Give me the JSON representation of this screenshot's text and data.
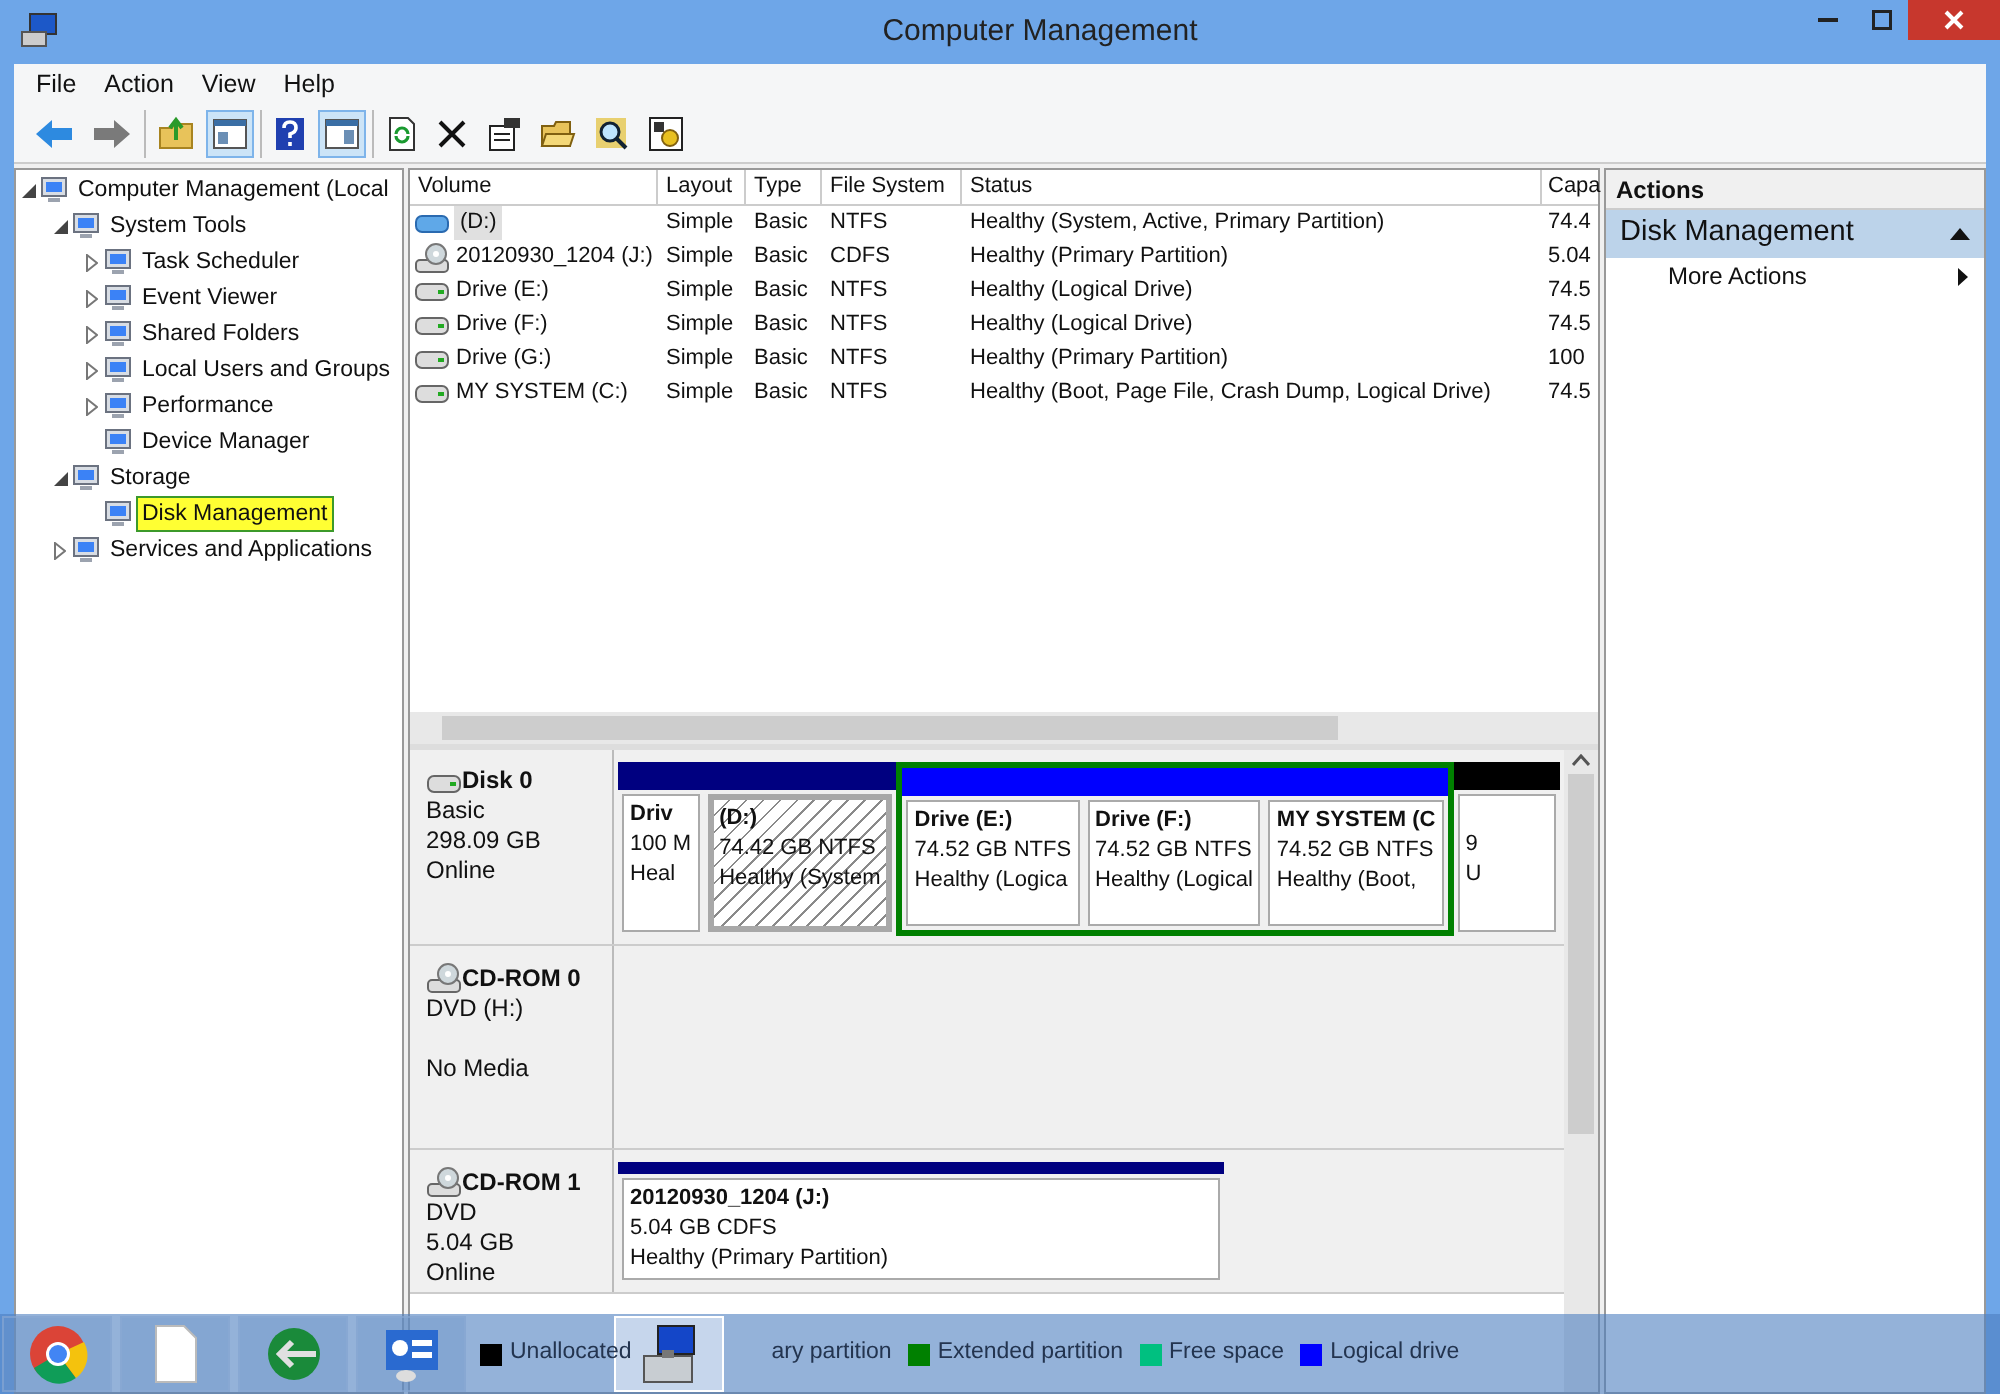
{
  "window": {
    "title": "Computer Management"
  },
  "menu": [
    "File",
    "Action",
    "View",
    "Help"
  ],
  "toolbar": [
    [
      {
        "kind": "back",
        "pressed": false
      },
      {
        "kind": "forward",
        "pressed": false
      }
    ],
    [
      {
        "kind": "up",
        "pressed": false
      },
      {
        "kind": "tree",
        "pressed": true
      }
    ],
    [
      {
        "kind": "help",
        "pressed": false
      },
      {
        "kind": "pane",
        "pressed": true
      }
    ],
    [
      {
        "kind": "refresh",
        "pressed": false
      },
      {
        "kind": "delete",
        "pressed": false
      },
      {
        "kind": "properties",
        "pressed": false
      },
      {
        "kind": "open",
        "pressed": false
      },
      {
        "kind": "search",
        "pressed": false
      },
      {
        "kind": "settings",
        "pressed": false
      }
    ]
  ],
  "tree": [
    {
      "label": "Computer Management (Local",
      "expanded": true,
      "selected": false,
      "children": [
        {
          "label": "System Tools",
          "expanded": true,
          "selected": false,
          "children": [
            {
              "label": "Task Scheduler",
              "expanded": false,
              "selected": false
            },
            {
              "label": "Event Viewer",
              "expanded": false,
              "selected": false
            },
            {
              "label": "Shared Folders",
              "expanded": false,
              "selected": false
            },
            {
              "label": "Local Users and Groups",
              "expanded": false,
              "selected": false
            },
            {
              "label": "Performance",
              "expanded": false,
              "selected": false
            },
            {
              "label": "Device Manager",
              "selected": false
            }
          ]
        },
        {
          "label": "Storage",
          "expanded": true,
          "selected": false,
          "children": [
            {
              "label": "Disk Management",
              "selected": true
            }
          ]
        },
        {
          "label": "Services and Applications",
          "expanded": false,
          "selected": false
        }
      ]
    }
  ],
  "volumes": {
    "columns": [
      "Volume",
      "Layout",
      "Type",
      "File System",
      "Status",
      "Capa"
    ],
    "rows": [
      {
        "kind": "blue-drive",
        "selected": true,
        "cells": [
          "(D:)",
          "Simple",
          "Basic",
          "NTFS",
          "Healthy (System, Active, Primary Partition)",
          "74.4"
        ]
      },
      {
        "kind": "cd",
        "selected": false,
        "cells": [
          "20120930_1204 (J:)",
          "Simple",
          "Basic",
          "CDFS",
          "Healthy (Primary Partition)",
          "5.04"
        ]
      },
      {
        "kind": "drive",
        "selected": false,
        "cells": [
          "Drive (E:)",
          "Simple",
          "Basic",
          "NTFS",
          "Healthy (Logical Drive)",
          "74.5"
        ]
      },
      {
        "kind": "drive",
        "selected": false,
        "cells": [
          "Drive (F:)",
          "Simple",
          "Basic",
          "NTFS",
          "Healthy (Logical Drive)",
          "74.5"
        ]
      },
      {
        "kind": "drive",
        "selected": false,
        "cells": [
          "Drive (G:)",
          "Simple",
          "Basic",
          "NTFS",
          "Healthy (Primary Partition)",
          "100"
        ]
      },
      {
        "kind": "drive",
        "selected": false,
        "cells": [
          "MY SYSTEM (C:)",
          "Simple",
          "Basic",
          "NTFS",
          "Healthy (Boot, Page File, Crash Dump, Logical Drive)",
          "74.5"
        ]
      }
    ]
  },
  "disks": [
    {
      "kind": "hdd",
      "name": "Disk 0",
      "lines": [
        "Basic",
        "298.09 GB",
        "Online"
      ],
      "partitions": [
        {
          "kind": "primary",
          "selected": false,
          "title": "Driv",
          "lines": [
            "100 M",
            "Heal"
          ]
        },
        {
          "kind": "primary",
          "selected": true,
          "title": "(D:)",
          "lines": [
            "74.42 GB NTFS",
            "Healthy (System"
          ]
        },
        {
          "kind": "extended",
          "children": [
            {
              "kind": "logical",
              "selected": false,
              "title": "Drive  (E:)",
              "lines": [
                "74.52 GB NTFS",
                "Healthy (Logica"
              ]
            },
            {
              "kind": "logical",
              "selected": false,
              "title": "Drive  (F:)",
              "lines": [
                "74.52 GB NTFS",
                "Healthy (Logical"
              ]
            },
            {
              "kind": "logical",
              "selected": false,
              "title": "MY SYSTEM  (C",
              "lines": [
                "74.52 GB NTFS",
                "Healthy (Boot,"
              ]
            }
          ]
        },
        {
          "kind": "unallocated",
          "selected": false,
          "lines": [
            "9",
            "U"
          ]
        }
      ]
    },
    {
      "kind": "cd",
      "name": "CD-ROM 0",
      "lines": [
        "DVD (H:)",
        "No Media"
      ]
    },
    {
      "kind": "cd",
      "name": "CD-ROM 1",
      "lines": [
        "DVD",
        "5.04 GB",
        "Online"
      ],
      "partitions": [
        {
          "kind": "primary",
          "selected": false,
          "title": "20120930_1204  (J:)",
          "lines": [
            "5.04 GB CDFS",
            "Healthy (Primary Partition)"
          ]
        }
      ]
    }
  ],
  "legend": [
    {
      "label": "Unallocated",
      "color": "#000000"
    },
    {
      "label": "ary partition"
    },
    {
      "label": "Extended partition",
      "color": "#008000"
    },
    {
      "label": "Free space",
      "color": "#00c080"
    },
    {
      "label": "Logical drive",
      "color": "#0000ff"
    }
  ],
  "actions": {
    "header": "Actions",
    "section": "Disk Management",
    "expanded": true,
    "items": [
      "More Actions"
    ]
  },
  "taskbar": [
    {
      "kind": "chrome",
      "active": false
    },
    {
      "kind": "file",
      "active": false
    },
    {
      "kind": "globe",
      "active": false
    },
    {
      "kind": "panel",
      "active": false
    },
    {
      "kind": "toolbox",
      "active": true
    }
  ]
}
